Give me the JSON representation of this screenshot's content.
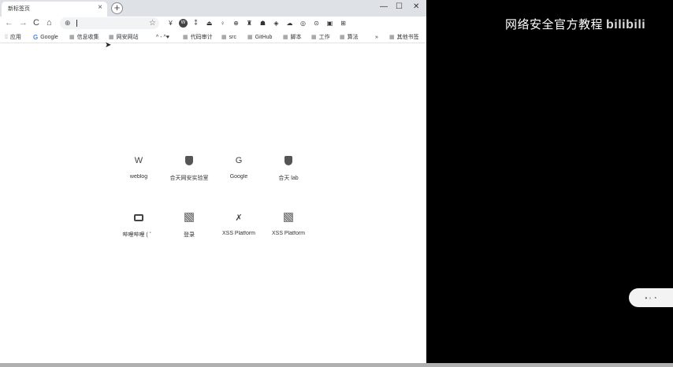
{
  "browser": {
    "tab_title": "新标签页",
    "tab_close": "×",
    "new_tab": "+",
    "window_controls": {
      "minimize": "—",
      "maximize": "☐",
      "close": "✕"
    }
  },
  "toolbar": {
    "back": "←",
    "forward": "→",
    "reload": "C",
    "home": "⌂",
    "omnibox_value": "",
    "star": "☆",
    "extensions": [
      "¥",
      "W",
      "⁑",
      "⏏",
      "♀",
      "⊕",
      "♜",
      "☗",
      "◈",
      "☁",
      "◎",
      "⊙",
      "▣",
      "⊞"
    ]
  },
  "bookmarks": [
    {
      "label": "应用",
      "icon": "apps-icon"
    },
    {
      "label": "Google",
      "icon": "google-icon"
    },
    {
      "label": "信息收集",
      "icon": "folder-icon"
    },
    {
      "label": "网安网站",
      "icon": "folder-icon"
    },
    {
      "label": "^ - ^♥",
      "icon": ""
    },
    {
      "label": "代码审计",
      "icon": "folder-icon"
    },
    {
      "label": "src",
      "icon": "folder-icon"
    },
    {
      "label": "GitHub",
      "icon": "folder-icon"
    },
    {
      "label": "脚本",
      "icon": "folder-icon"
    },
    {
      "label": "工作",
      "icon": "folder-icon"
    },
    {
      "label": "算法",
      "icon": "folder-icon"
    },
    {
      "label": "»",
      "icon": ""
    },
    {
      "label": "其他书签",
      "icon": "folder-icon"
    }
  ],
  "shortcuts": [
    {
      "label": "weblog",
      "icon": "W"
    },
    {
      "label": "合天网安实验室",
      "icon": "shield"
    },
    {
      "label": "Google",
      "icon": "G"
    },
    {
      "label": "合天 lab",
      "icon": "shield"
    },
    {
      "label": "哔哩哔哩 ( ゜",
      "icon": "tv"
    },
    {
      "label": "登录",
      "icon": "qr"
    },
    {
      "label": "XSS Platform",
      "icon": "✗"
    },
    {
      "label": "XSS Platform",
      "icon": "qr"
    }
  ],
  "overlay": {
    "watermark": "网络安全官方教程",
    "logo": "bilibili",
    "float_button": "• ◦ ◔"
  }
}
